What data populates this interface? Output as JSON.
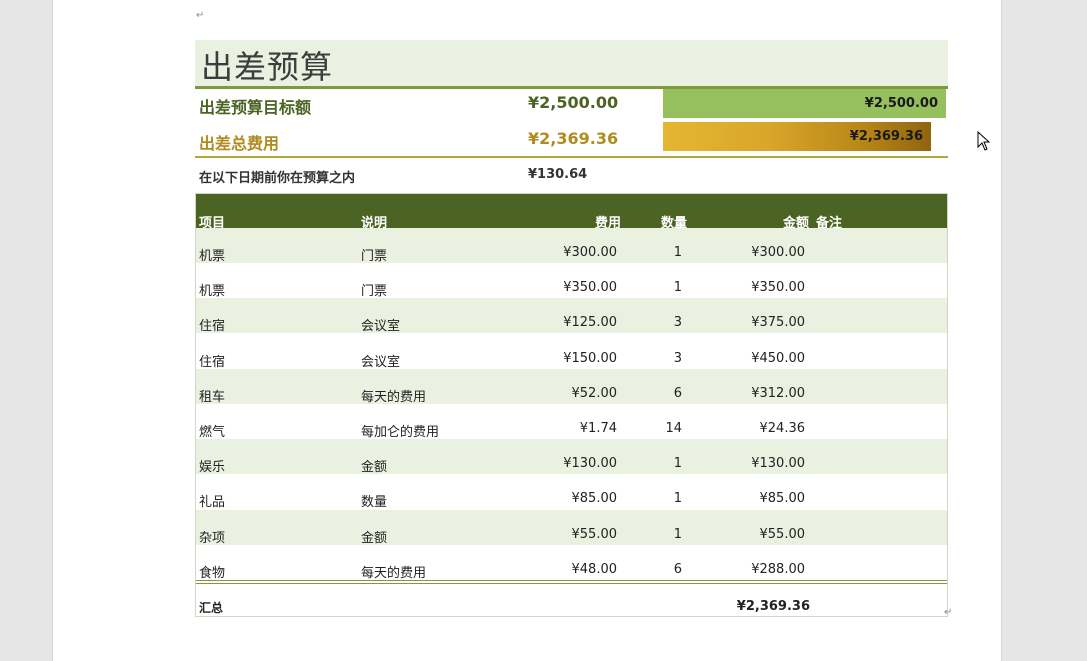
{
  "title": "出差预算",
  "summary": {
    "target_label": "出差预算目标额",
    "target_value": "¥2,500.00",
    "target_bar_label": "¥2,500.00",
    "total_label": "出差总费用",
    "total_value": "¥2,369.36",
    "total_bar_label": "¥2,369.36",
    "remain_label": "在以下日期前你在预算之内",
    "remain_value": "¥130.64"
  },
  "colors": {
    "target_label": "#4b6323",
    "total_label": "#b08b1d",
    "header_bg": "#4b6323",
    "band_row": "#eaf1e0"
  },
  "table": {
    "headers": {
      "item": "项目",
      "desc": "说明",
      "cost": "费用",
      "qty": "数量",
      "amount": "金额",
      "notes": "备注"
    },
    "rows": [
      {
        "item": "机票",
        "desc": "门票",
        "cost": "¥300.00",
        "qty": "1",
        "amount": "¥300.00"
      },
      {
        "item": "机票",
        "desc": "门票",
        "cost": "¥350.00",
        "qty": "1",
        "amount": "¥350.00"
      },
      {
        "item": "住宿",
        "desc": "会议室",
        "cost": "¥125.00",
        "qty": "3",
        "amount": "¥375.00"
      },
      {
        "item": "住宿",
        "desc": "会议室",
        "cost": "¥150.00",
        "qty": "3",
        "amount": "¥450.00"
      },
      {
        "item": "租车",
        "desc": "每天的费用",
        "cost": "¥52.00",
        "qty": "6",
        "amount": "¥312.00"
      },
      {
        "item": "燃气",
        "desc": "每加仑的费用",
        "cost": "¥1.74",
        "qty": "14",
        "amount": "¥24.36"
      },
      {
        "item": "娱乐",
        "desc": "金额",
        "cost": "¥130.00",
        "qty": "1",
        "amount": "¥130.00"
      },
      {
        "item": "礼品",
        "desc": "数量",
        "cost": "¥85.00",
        "qty": "1",
        "amount": "¥85.00"
      },
      {
        "item": "杂项",
        "desc": "金额",
        "cost": "¥55.00",
        "qty": "1",
        "amount": "¥55.00"
      },
      {
        "item": "食物",
        "desc": "每天的费用",
        "cost": "¥48.00",
        "qty": "6",
        "amount": "¥288.00"
      }
    ],
    "total_label": "汇总",
    "total_value": "¥2,369.36"
  },
  "icons": {
    "paragraph_mark": "↵",
    "cursor": "mouse-pointer-icon"
  }
}
